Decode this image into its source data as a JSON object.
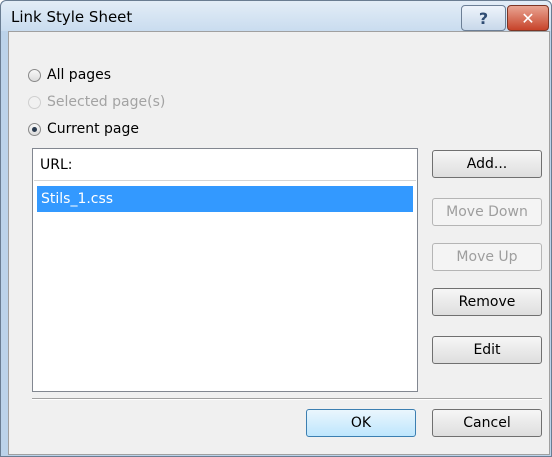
{
  "window": {
    "title": "Link Style Sheet",
    "help_glyph": "?",
    "close_glyph": "✕"
  },
  "scope_options": [
    {
      "label": "All pages",
      "checked": false,
      "enabled": true
    },
    {
      "label": "Selected page(s)",
      "checked": false,
      "enabled": false
    },
    {
      "label": "Current page",
      "checked": true,
      "enabled": true
    }
  ],
  "url_list": {
    "header": "URL:",
    "items": [
      "Stils_1.css"
    ],
    "selected_index": 0
  },
  "side_buttons": {
    "add": "Add...",
    "move_down": "Move Down",
    "move_up": "Move Up",
    "remove": "Remove",
    "edit": "Edit"
  },
  "footer_buttons": {
    "ok": "OK",
    "cancel": "Cancel"
  },
  "colors": {
    "selection": "#3399ff",
    "title_bar": "#c9dcef",
    "close_button": "#c7432a"
  }
}
